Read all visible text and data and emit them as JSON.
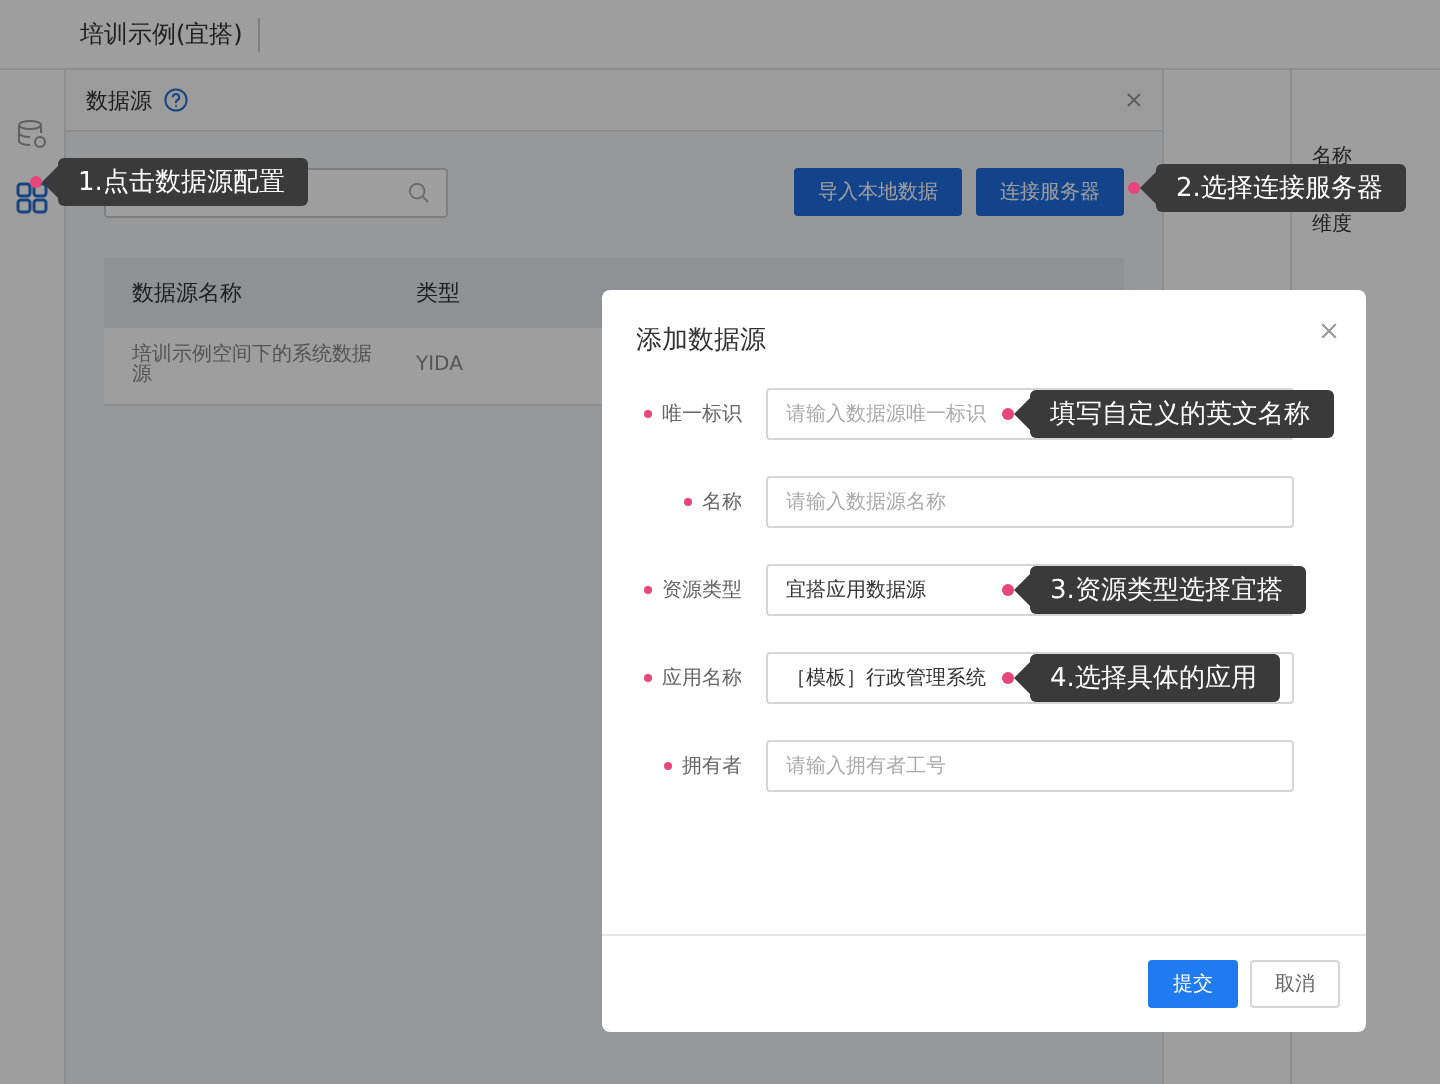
{
  "app": {
    "title": "培训示例(宜搭)"
  },
  "sidebar": {
    "items": [
      {
        "kind": "database",
        "selected": false
      },
      {
        "kind": "grid",
        "selected": true
      }
    ]
  },
  "panel": {
    "title": "数据源",
    "callout": "1.点击数据源配置",
    "buttons": [
      "导入本地数据",
      "连接服务器"
    ],
    "buttons_callout": "2.选择连接服务器",
    "table": {
      "columns": [
        "数据源名称",
        "类型"
      ],
      "rows": [
        [
          "培训示例空间下的系统数据源",
          "YIDA"
        ]
      ]
    }
  },
  "side_panel": {
    "labels": [
      "名称",
      "维度"
    ]
  },
  "dialog": {
    "title": "添加数据源",
    "fields": [
      {
        "label": "唯一标识",
        "required": true,
        "placeholder": "请输入数据源唯一标识",
        "callout": "填写自定义的英文名称"
      },
      {
        "label": "名称",
        "required": true,
        "placeholder": "请输入数据源名称"
      },
      {
        "label": "资源类型",
        "required": true,
        "value": "宜搭应用数据源",
        "callout": "3.资源类型选择宜搭"
      },
      {
        "label": "应用名称",
        "required": true,
        "value": "［模板］行政管理系统",
        "callout": "4.选择具体的应用"
      },
      {
        "label": "拥有者",
        "required": true,
        "placeholder": "请输入拥有者工号"
      }
    ],
    "buttons": [
      {
        "label": "提交",
        "kind": "primary"
      },
      {
        "label": "取消",
        "kind": "default"
      }
    ]
  }
}
